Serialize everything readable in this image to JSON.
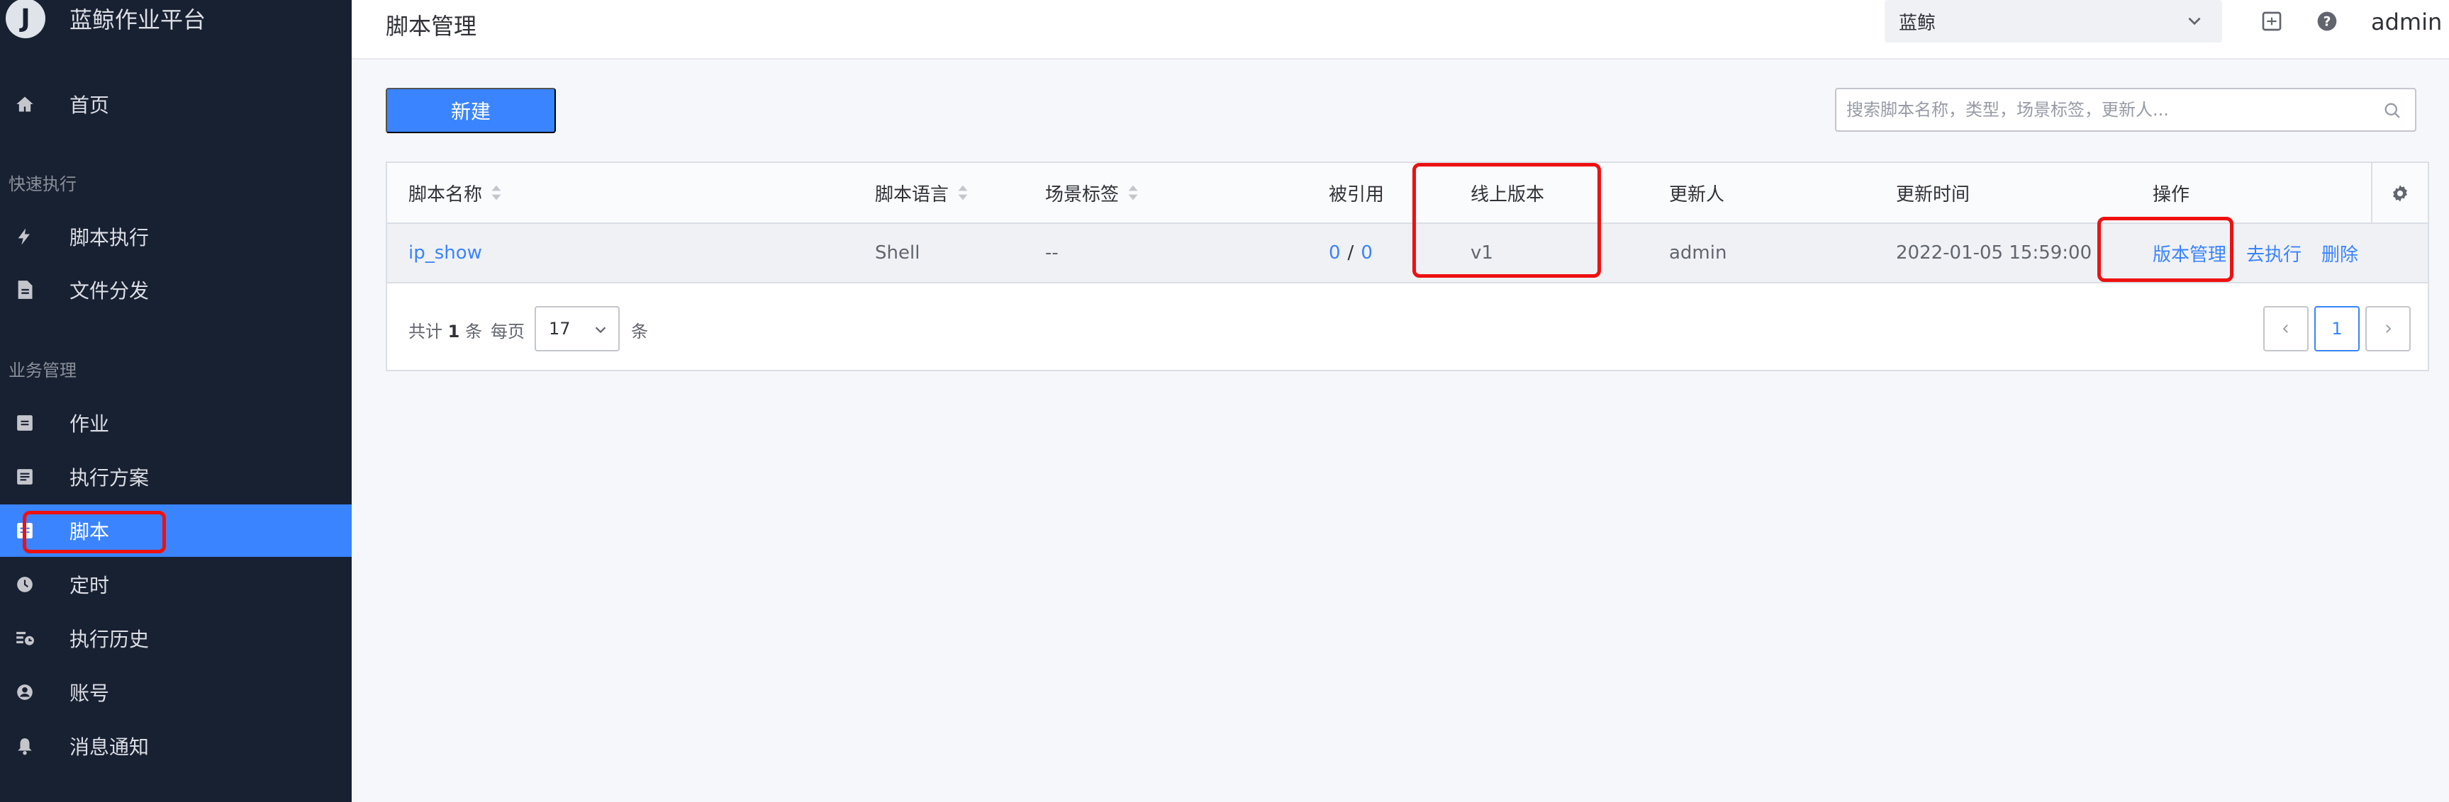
{
  "sidebar": {
    "logo_letter": "J",
    "brand": "蓝鲸作业平台",
    "home": {
      "label": "首页",
      "icon": "home-icon"
    },
    "groups": [
      {
        "title": "快速执行",
        "items": [
          {
            "label": "脚本执行",
            "icon": "bolt-icon"
          },
          {
            "label": "文件分发",
            "icon": "file-icon"
          }
        ]
      },
      {
        "title": "业务管理",
        "items": [
          {
            "label": "作业",
            "icon": "job-icon"
          },
          {
            "label": "执行方案",
            "icon": "plan-icon"
          },
          {
            "label": "脚本",
            "icon": "script-icon",
            "active": true
          },
          {
            "label": "定时",
            "icon": "clock-icon"
          },
          {
            "label": "执行历史",
            "icon": "history-icon"
          },
          {
            "label": "账号",
            "icon": "account-icon"
          },
          {
            "label": "消息通知",
            "icon": "bell-icon"
          }
        ]
      }
    ]
  },
  "header": {
    "title": "脚本管理",
    "business_select": "蓝鲸",
    "user": "admin"
  },
  "toolbar": {
    "new_label": "新建",
    "search_placeholder": "搜索脚本名称，类型，场景标签，更新人..."
  },
  "table": {
    "columns": [
      "脚本名称",
      "脚本语言",
      "场景标签",
      "被引用",
      "线上版本",
      "更新人",
      "更新时间",
      "操作"
    ],
    "rows": [
      {
        "name": "ip_show",
        "language": "Shell",
        "tags": "--",
        "ref_a": "0",
        "ref_sep": "/",
        "ref_b": "0",
        "online_version": "v1",
        "updater": "admin",
        "updated_at": "2022-01-05 15:59:00",
        "actions": [
          "版本管理",
          "去执行",
          "删除"
        ]
      }
    ]
  },
  "pagination": {
    "total_prefix": "共计",
    "total": "1",
    "total_suffix": "条",
    "per_page_label": "每页",
    "per_page": "17",
    "per_page_suffix": "条",
    "current_page": "1"
  },
  "colors": {
    "sidebar_bg": "#182132",
    "accent": "#3a84ff",
    "highlight": "#ee1111"
  }
}
